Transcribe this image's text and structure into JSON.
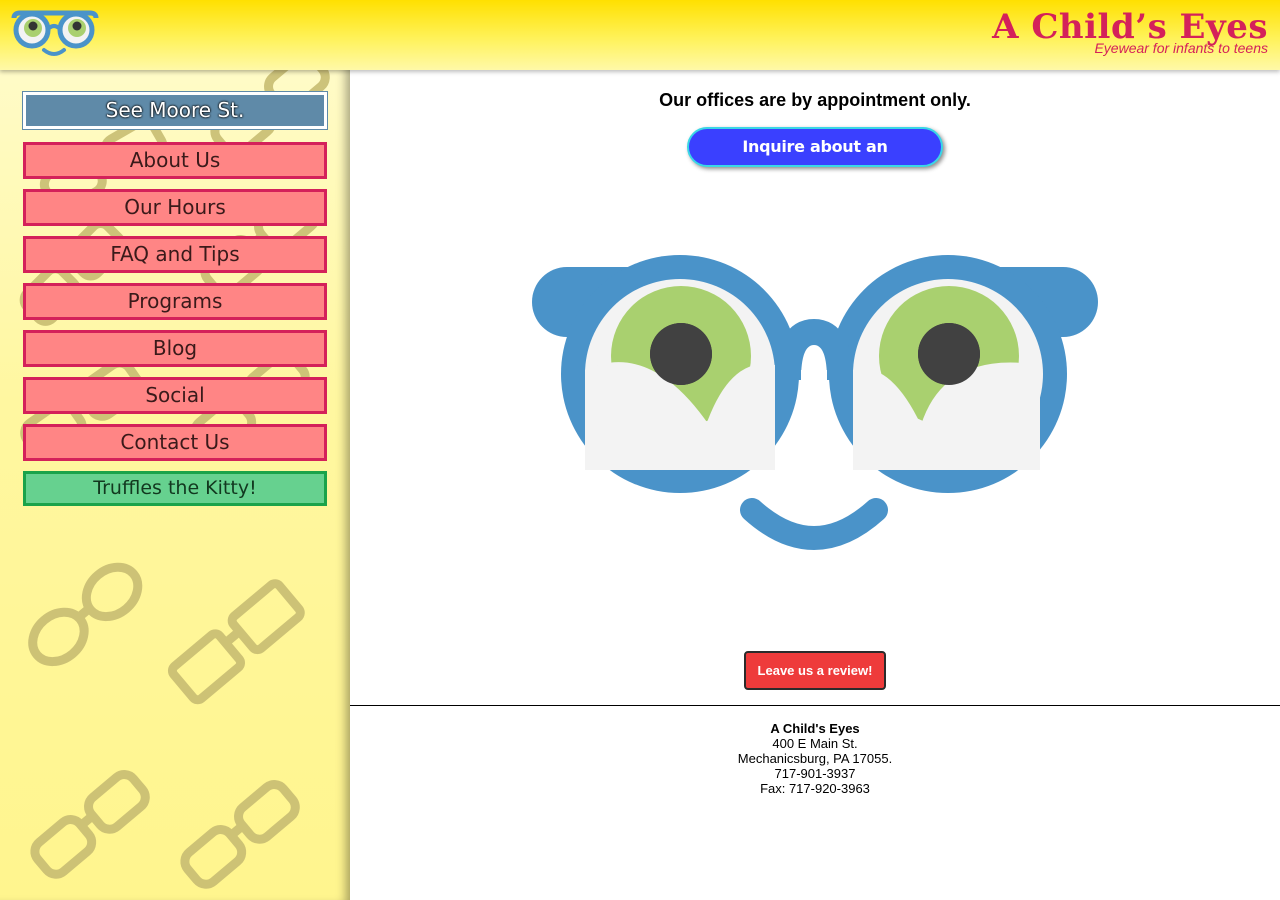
{
  "header": {
    "brand_title": "A Child’s Eyes",
    "brand_subtitle": "Eyewear for infants  to teens",
    "logo_icon": "glasses-face-icon",
    "brand_color": "#d4215a"
  },
  "sidebar": {
    "featured_label": "See Moore St.",
    "items": [
      {
        "label": "About Us"
      },
      {
        "label": "Our Hours"
      },
      {
        "label": "FAQ and Tips"
      },
      {
        "label": "Programs"
      },
      {
        "label": "Blog"
      },
      {
        "label": "Social"
      },
      {
        "label": "Contact Us"
      }
    ],
    "special_label": "Truffles the Kitty!",
    "colors": {
      "nav_fill": "#ff8585",
      "nav_border": "#d4215a",
      "special_fill": "#66d18f",
      "featured_fill": "#5f8aa8"
    }
  },
  "main": {
    "notice": "Our offices are by appointment only.",
    "appointment_button": "Inquire about an appointment",
    "mascot_icon": "glasses-mascot-icon",
    "review_button": "Leave us a review!"
  },
  "footer": {
    "name": "A Child's Eyes",
    "address_line1": "400 E Main St.",
    "address_line2": "Mechanicsburg, PA 17055.",
    "phone": "717-901-3937",
    "fax": "Fax: 717-920-3963"
  }
}
